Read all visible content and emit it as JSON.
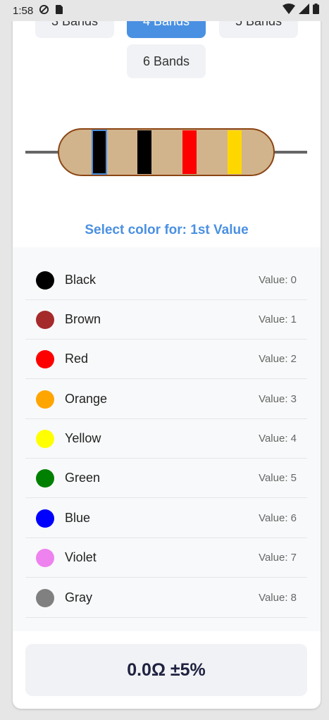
{
  "status_bar": {
    "time": "1:58"
  },
  "band_options": [
    "3 Bands",
    "4 Bands",
    "5 Bands",
    "6 Bands"
  ],
  "selected_band_option": "4 Bands",
  "resistor": {
    "body_color": "#d2b48c",
    "bands": [
      {
        "color": "#000000",
        "selected": true
      },
      {
        "color": "#000000",
        "selected": false
      },
      {
        "color": "#ff0000",
        "selected": false
      },
      {
        "color": "#ffd700",
        "selected": false
      }
    ]
  },
  "prompt": "Select color for: 1st Value",
  "colors": [
    {
      "name": "Black",
      "value_label": "Value: 0",
      "hex": "#000000"
    },
    {
      "name": "Brown",
      "value_label": "Value: 1",
      "hex": "#a52a2a"
    },
    {
      "name": "Red",
      "value_label": "Value: 2",
      "hex": "#ff0000"
    },
    {
      "name": "Orange",
      "value_label": "Value: 3",
      "hex": "#ffa500"
    },
    {
      "name": "Yellow",
      "value_label": "Value: 4",
      "hex": "#ffff00"
    },
    {
      "name": "Green",
      "value_label": "Value: 5",
      "hex": "#008000"
    },
    {
      "name": "Blue",
      "value_label": "Value: 6",
      "hex": "#0000ff"
    },
    {
      "name": "Violet",
      "value_label": "Value: 7",
      "hex": "#ee82ee"
    },
    {
      "name": "Gray",
      "value_label": "Value: 8",
      "hex": "#808080"
    }
  ],
  "result": "0.0Ω ±5%",
  "theme": {
    "accent": "#4a90e2"
  }
}
